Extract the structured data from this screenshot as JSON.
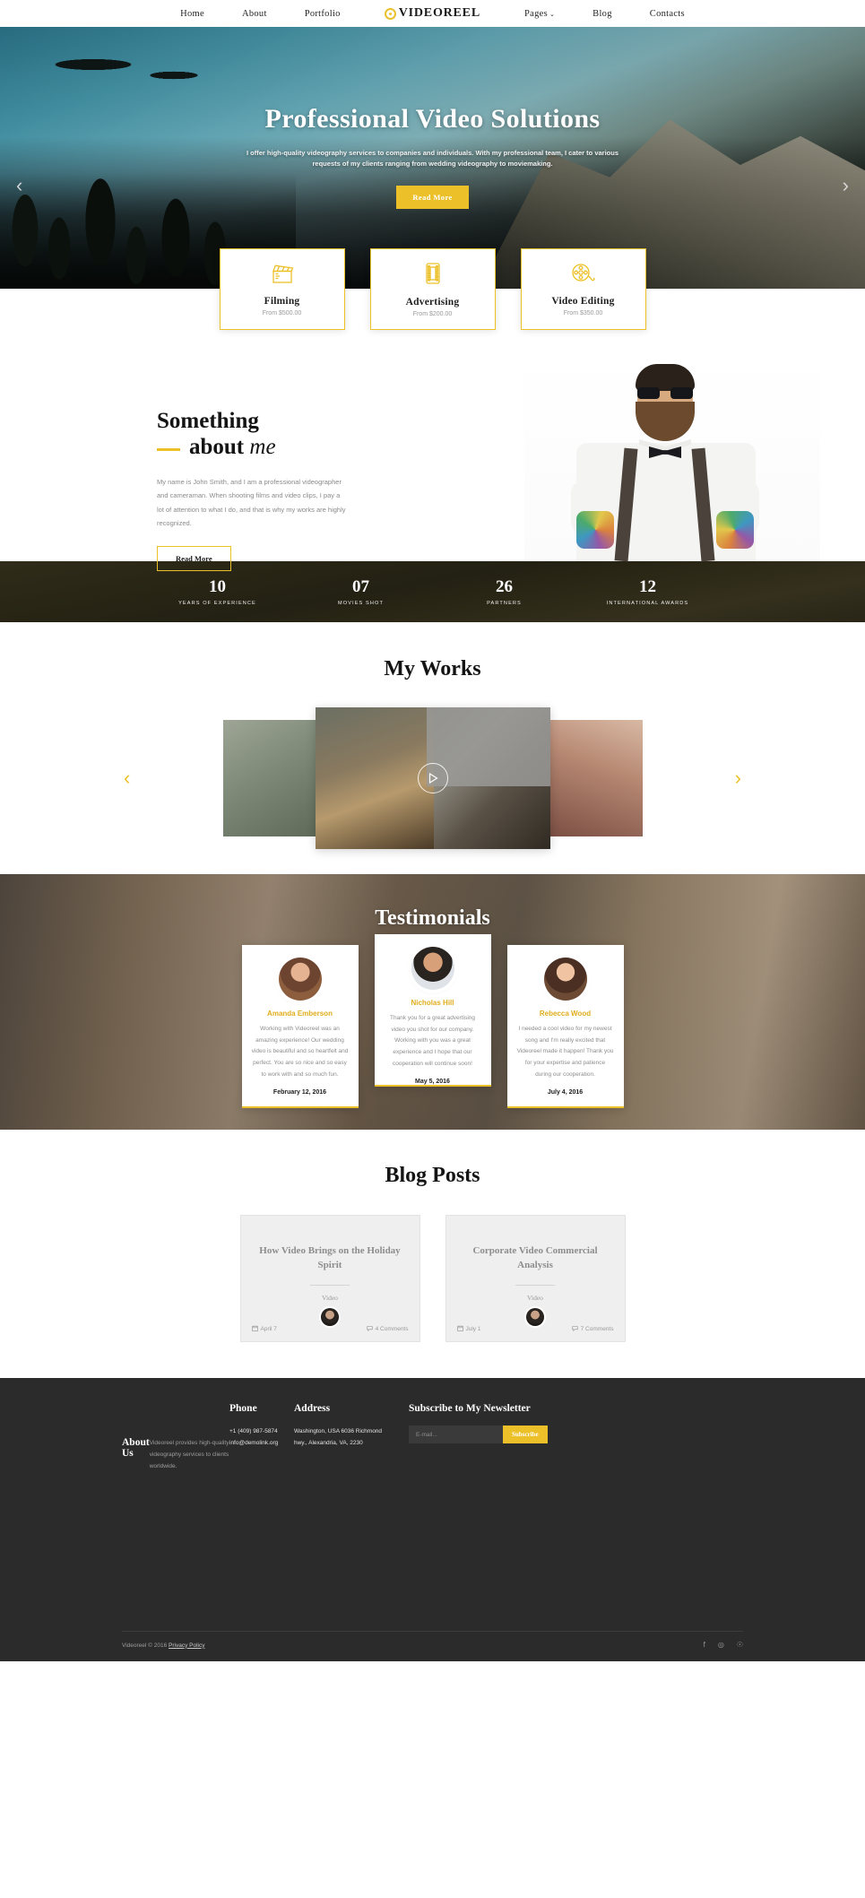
{
  "header": {
    "nav_left": [
      {
        "label": "Home",
        "name": "nav-home"
      },
      {
        "label": "About",
        "name": "nav-about"
      },
      {
        "label": "Portfolio",
        "name": "nav-portfolio"
      }
    ],
    "logo": "VIDEOREEL",
    "nav_right": [
      {
        "label": "Pages",
        "name": "nav-pages",
        "caret": "⌄"
      },
      {
        "label": "Blog",
        "name": "nav-blog"
      },
      {
        "label": "Contacts",
        "name": "nav-contacts"
      }
    ]
  },
  "hero": {
    "title": "Professional Video Solutions",
    "subtitle": "I offer high-quality videography services to companies and individuals. With my professional team, I cater to various requests of my clients ranging from wedding videography to moviemaking.",
    "button": "Read More",
    "prev": "‹",
    "next": "›"
  },
  "services": [
    {
      "name": "Filming",
      "price": "From $500.00",
      "icon": "clapperboard-icon"
    },
    {
      "name": "Advertising",
      "price": "From $200.00",
      "icon": "film-strip-icon"
    },
    {
      "name": "Video Editing",
      "price": "From $350.00",
      "icon": "film-reel-icon"
    }
  ],
  "about": {
    "heading_line1": "Something",
    "heading_line2": "about",
    "heading_italic": "me",
    "paragraph": "My name is John Smith, and I am a professional videographer and cameraman. When shooting films and video clips, I pay a lot of attention to what I do, and that is why my works are highly recognized.",
    "button": "Read More"
  },
  "counters": [
    {
      "value": "10",
      "label": "YEARS OF EXPERIENCE"
    },
    {
      "value": "07",
      "label": "MOVIES SHOT"
    },
    {
      "value": "26",
      "label": "PARTNERS"
    },
    {
      "value": "12",
      "label": "INTERNATIONAL AWARDS"
    }
  ],
  "works": {
    "title": "My Works",
    "prev": "‹",
    "next": "›"
  },
  "testimonials": {
    "title": "Testimonials",
    "items": [
      {
        "name": "Amanda Emberson",
        "text": "Working with Videoreel was an amazing experience! Our wedding video is beautiful and so heartfelt and perfect. You are so nice and so easy to work with and so much fun.",
        "date": "February 12, 2016"
      },
      {
        "name": "Nicholas Hill",
        "text": "Thank you for a great advertising video you shot for our company. Working with you was a great experience and I hope that our cooperation will continue soon!",
        "date": "May 5, 2016"
      },
      {
        "name": "Rebecca Wood",
        "text": "I needed a cool video for my newest song and I'm really excited that Videoreel made it happen! Thank you for your expertise and patience during our cooperation.",
        "date": "July 4, 2016"
      }
    ]
  },
  "blog": {
    "title": "Blog Posts",
    "posts": [
      {
        "title": "How Video Brings on the Holiday Spirit",
        "category": "Video",
        "date": "April 7",
        "comments": "4 Comments"
      },
      {
        "title": "Corporate Video Commercial Analysis",
        "category": "Video",
        "date": "July 1",
        "comments": "7 Comments"
      }
    ]
  },
  "footer": {
    "about_title": "About Us",
    "about_text": "Videoreel provides high-quality videography services to clients worldwide.",
    "phone_title": "Phone",
    "phone_number": "+1 (409) 987-5874",
    "phone_email": "info@demolink.org",
    "address_title": "Address",
    "address_line1": "Washington, USA 6036 Richmond",
    "address_line2": "hwy., Alexandria, VA, 2230",
    "newsletter_title": "Subscribe to My Newsletter",
    "email_placeholder": "E-mail...",
    "subscribe_button": "Subscribe",
    "copyright": "Videoreel © 2016 ",
    "privacy": "Privacy Policy",
    "socials": [
      {
        "glyph": "f",
        "name": "facebook-icon"
      },
      {
        "glyph": "◎",
        "name": "instagram-icon"
      },
      {
        "glyph": "☉",
        "name": "google-plus-icon"
      }
    ]
  },
  "colors": {
    "accent": "#ecc028",
    "dark": "#2b2b2b",
    "text": "#3a3a3a"
  }
}
